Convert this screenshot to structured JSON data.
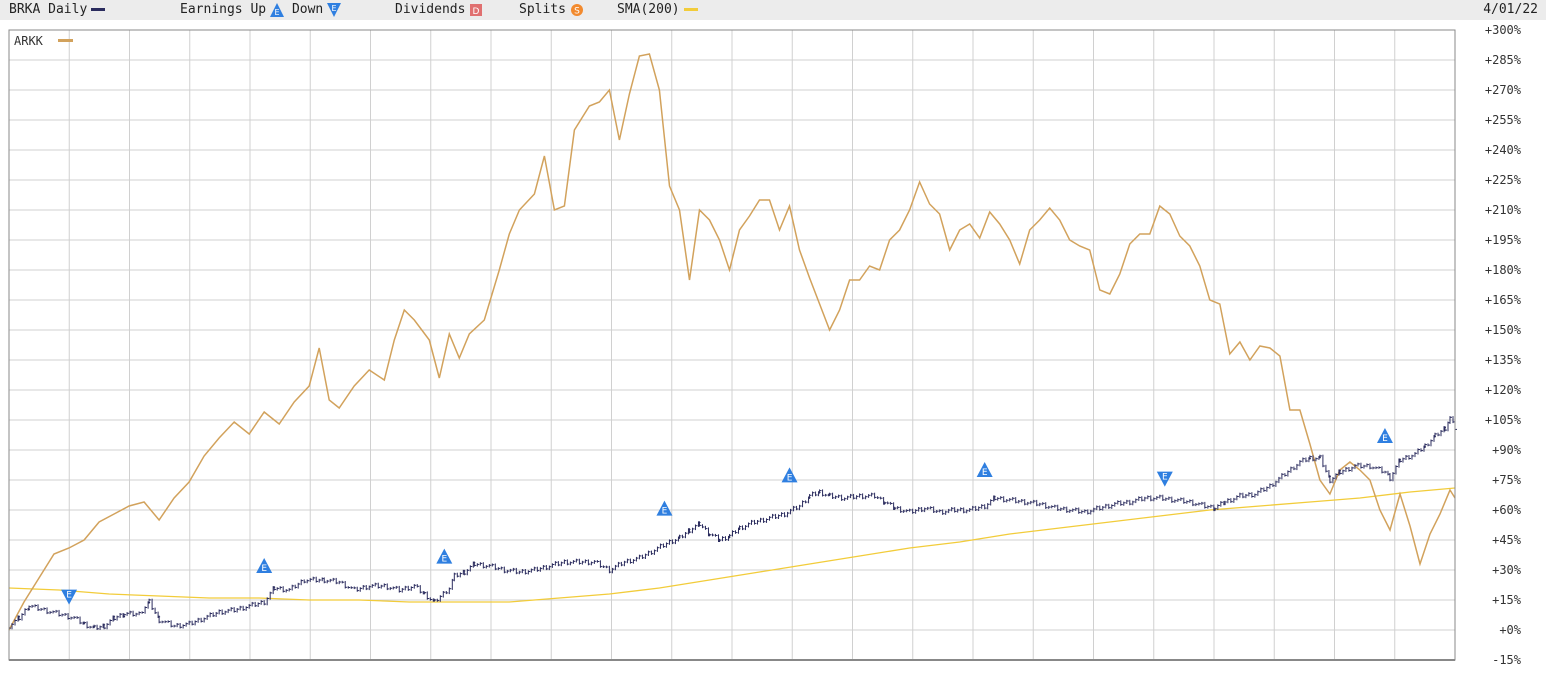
{
  "header": {
    "symbol_label": "BRKA Daily",
    "earnings_label": "Earnings",
    "up_label": "Up",
    "down_label": "Down",
    "dividends_label": "Dividends",
    "splits_label": "Splits",
    "sma_label": "SMA(200)",
    "date": "4/01/22",
    "colors": {
      "brka": "#2b2c5e",
      "arkk": "#d2a25c",
      "sma": "#f2cc3a",
      "earnings_icon": "#2f7fe0",
      "dividends_icon": "#e07070",
      "splits_icon": "#f28a2e"
    }
  },
  "chart_data": {
    "type": "line",
    "x_unit": "trading days (unlabeled time axis, ends 4/01/22)",
    "y_unit": "percent change",
    "ylim": [
      -15,
      300
    ],
    "y_ticks": [
      "+300%",
      "+285%",
      "+270%",
      "+255%",
      "+240%",
      "+225%",
      "+210%",
      "+195%",
      "+180%",
      "+165%",
      "+150%",
      "+135%",
      "+120%",
      "+105%",
      "+90%",
      "+75%",
      "+60%",
      "+45%",
      "+30%",
      "+15%",
      "+0%",
      "-15%"
    ],
    "grid": true,
    "inner_legend": "ARKK",
    "x_range": [
      0,
      1445
    ],
    "series": [
      {
        "name": "ARKK",
        "style": "line",
        "color": "#d2a25c",
        "points": [
          [
            0,
            0
          ],
          [
            15,
            14
          ],
          [
            30,
            26
          ],
          [
            45,
            38
          ],
          [
            60,
            41
          ],
          [
            75,
            45
          ],
          [
            90,
            54
          ],
          [
            105,
            58
          ],
          [
            120,
            62
          ],
          [
            135,
            64
          ],
          [
            150,
            55
          ],
          [
            165,
            66
          ],
          [
            180,
            74
          ],
          [
            195,
            87
          ],
          [
            210,
            96
          ],
          [
            225,
            104
          ],
          [
            240,
            98
          ],
          [
            255,
            109
          ],
          [
            270,
            103
          ],
          [
            285,
            114
          ],
          [
            300,
            122
          ],
          [
            310,
            141
          ],
          [
            320,
            115
          ],
          [
            330,
            111
          ],
          [
            345,
            122
          ],
          [
            360,
            130
          ],
          [
            375,
            125
          ],
          [
            385,
            145
          ],
          [
            395,
            160
          ],
          [
            405,
            155
          ],
          [
            420,
            145
          ],
          [
            430,
            126
          ],
          [
            440,
            148
          ],
          [
            450,
            136
          ],
          [
            460,
            148
          ],
          [
            475,
            155
          ],
          [
            490,
            180
          ],
          [
            500,
            198
          ],
          [
            510,
            210
          ],
          [
            525,
            218
          ],
          [
            535,
            237
          ],
          [
            545,
            210
          ],
          [
            555,
            212
          ],
          [
            565,
            250
          ],
          [
            580,
            262
          ],
          [
            590,
            264
          ],
          [
            600,
            270
          ],
          [
            610,
            245
          ],
          [
            620,
            268
          ],
          [
            630,
            287
          ],
          [
            640,
            288
          ],
          [
            650,
            270
          ],
          [
            660,
            222
          ],
          [
            670,
            210
          ],
          [
            680,
            175
          ],
          [
            690,
            210
          ],
          [
            700,
            205
          ],
          [
            710,
            195
          ],
          [
            720,
            180
          ],
          [
            730,
            200
          ],
          [
            740,
            207
          ],
          [
            750,
            215
          ],
          [
            760,
            215
          ],
          [
            770,
            200
          ],
          [
            780,
            212
          ],
          [
            790,
            190
          ],
          [
            800,
            176
          ],
          [
            810,
            163
          ],
          [
            820,
            150
          ],
          [
            830,
            160
          ],
          [
            840,
            175
          ],
          [
            850,
            175
          ],
          [
            860,
            182
          ],
          [
            870,
            180
          ],
          [
            880,
            195
          ],
          [
            890,
            200
          ],
          [
            900,
            210
          ],
          [
            910,
            224
          ],
          [
            920,
            213
          ],
          [
            930,
            208
          ],
          [
            940,
            190
          ],
          [
            950,
            200
          ],
          [
            960,
            203
          ],
          [
            970,
            196
          ],
          [
            980,
            209
          ],
          [
            990,
            203
          ],
          [
            1000,
            195
          ],
          [
            1010,
            183
          ],
          [
            1020,
            200
          ],
          [
            1030,
            205
          ],
          [
            1040,
            211
          ],
          [
            1050,
            205
          ],
          [
            1060,
            195
          ],
          [
            1070,
            192
          ],
          [
            1080,
            190
          ],
          [
            1090,
            170
          ],
          [
            1100,
            168
          ],
          [
            1110,
            178
          ],
          [
            1120,
            193
          ],
          [
            1130,
            198
          ],
          [
            1140,
            198
          ],
          [
            1150,
            212
          ],
          [
            1160,
            208
          ],
          [
            1170,
            197
          ],
          [
            1180,
            192
          ],
          [
            1190,
            182
          ],
          [
            1200,
            165
          ],
          [
            1210,
            163
          ],
          [
            1220,
            138
          ],
          [
            1230,
            144
          ],
          [
            1240,
            135
          ],
          [
            1250,
            142
          ],
          [
            1260,
            141
          ],
          [
            1270,
            137
          ],
          [
            1280,
            110
          ],
          [
            1290,
            110
          ],
          [
            1300,
            93
          ],
          [
            1310,
            75
          ],
          [
            1320,
            68
          ],
          [
            1330,
            80
          ],
          [
            1340,
            84
          ],
          [
            1350,
            80
          ],
          [
            1360,
            75
          ],
          [
            1370,
            60
          ],
          [
            1380,
            50
          ],
          [
            1390,
            68
          ],
          [
            1400,
            52
          ],
          [
            1410,
            33
          ],
          [
            1420,
            48
          ],
          [
            1430,
            58
          ],
          [
            1440,
            70
          ],
          [
            1445,
            66
          ]
        ]
      },
      {
        "name": "BRKA",
        "style": "bars",
        "color": "#2b2c5e",
        "points": [
          [
            0,
            2
          ],
          [
            10,
            6
          ],
          [
            20,
            12
          ],
          [
            35,
            10
          ],
          [
            50,
            8
          ],
          [
            65,
            6
          ],
          [
            75,
            3
          ],
          [
            85,
            1
          ],
          [
            95,
            2
          ],
          [
            105,
            6
          ],
          [
            115,
            8
          ],
          [
            130,
            8
          ],
          [
            140,
            14
          ],
          [
            150,
            5
          ],
          [
            165,
            2
          ],
          [
            180,
            3
          ],
          [
            195,
            6
          ],
          [
            210,
            9
          ],
          [
            225,
            10
          ],
          [
            240,
            12
          ],
          [
            255,
            14
          ],
          [
            265,
            21
          ],
          [
            280,
            20
          ],
          [
            295,
            25
          ],
          [
            315,
            25
          ],
          [
            330,
            24
          ],
          [
            345,
            20
          ],
          [
            360,
            22
          ],
          [
            375,
            22
          ],
          [
            390,
            20
          ],
          [
            405,
            22
          ],
          [
            415,
            18
          ],
          [
            425,
            14
          ],
          [
            440,
            21
          ],
          [
            445,
            27
          ],
          [
            455,
            29
          ],
          [
            465,
            33
          ],
          [
            480,
            32
          ],
          [
            495,
            30
          ],
          [
            510,
            29
          ],
          [
            525,
            30
          ],
          [
            540,
            32
          ],
          [
            555,
            34
          ],
          [
            570,
            34
          ],
          [
            585,
            34
          ],
          [
            600,
            30
          ],
          [
            615,
            34
          ],
          [
            630,
            36
          ],
          [
            645,
            40
          ],
          [
            660,
            44
          ],
          [
            670,
            46
          ],
          [
            680,
            50
          ],
          [
            690,
            53
          ],
          [
            700,
            48
          ],
          [
            710,
            45
          ],
          [
            720,
            47
          ],
          [
            730,
            51
          ],
          [
            745,
            54
          ],
          [
            760,
            56
          ],
          [
            775,
            58
          ],
          [
            790,
            62
          ],
          [
            800,
            67
          ],
          [
            810,
            69
          ],
          [
            820,
            67
          ],
          [
            835,
            66
          ],
          [
            850,
            67
          ],
          [
            865,
            67
          ],
          [
            875,
            64
          ],
          [
            885,
            61
          ],
          [
            900,
            59
          ],
          [
            915,
            61
          ],
          [
            930,
            59
          ],
          [
            945,
            60
          ],
          [
            960,
            60
          ],
          [
            975,
            62
          ],
          [
            985,
            66
          ],
          [
            1000,
            65
          ],
          [
            1015,
            64
          ],
          [
            1030,
            63
          ],
          [
            1045,
            61
          ],
          [
            1060,
            60
          ],
          [
            1075,
            59
          ],
          [
            1090,
            61
          ],
          [
            1105,
            63
          ],
          [
            1120,
            64
          ],
          [
            1135,
            66
          ],
          [
            1150,
            66
          ],
          [
            1165,
            65
          ],
          [
            1180,
            64
          ],
          [
            1195,
            62
          ],
          [
            1205,
            61
          ],
          [
            1215,
            64
          ],
          [
            1230,
            67
          ],
          [
            1245,
            68
          ],
          [
            1260,
            72
          ],
          [
            1275,
            78
          ],
          [
            1290,
            84
          ],
          [
            1300,
            86
          ],
          [
            1310,
            86
          ],
          [
            1320,
            75
          ],
          [
            1330,
            79
          ],
          [
            1345,
            82
          ],
          [
            1360,
            82
          ],
          [
            1375,
            79
          ],
          [
            1380,
            76
          ],
          [
            1390,
            85
          ],
          [
            1405,
            88
          ],
          [
            1415,
            92
          ],
          [
            1425,
            97
          ],
          [
            1435,
            101
          ],
          [
            1440,
            106
          ],
          [
            1445,
            101
          ]
        ]
      },
      {
        "name": "SMA(200)",
        "style": "line",
        "color": "#f2cc3a",
        "points": [
          [
            0,
            21
          ],
          [
            50,
            20
          ],
          [
            100,
            18
          ],
          [
            150,
            17
          ],
          [
            200,
            16
          ],
          [
            250,
            16
          ],
          [
            300,
            15
          ],
          [
            350,
            15
          ],
          [
            400,
            14
          ],
          [
            450,
            14
          ],
          [
            500,
            14
          ],
          [
            550,
            16
          ],
          [
            600,
            18
          ],
          [
            650,
            21
          ],
          [
            700,
            25
          ],
          [
            750,
            29
          ],
          [
            800,
            33
          ],
          [
            850,
            37
          ],
          [
            900,
            41
          ],
          [
            950,
            44
          ],
          [
            1000,
            48
          ],
          [
            1050,
            51
          ],
          [
            1100,
            54
          ],
          [
            1150,
            57
          ],
          [
            1200,
            60
          ],
          [
            1250,
            62
          ],
          [
            1300,
            64
          ],
          [
            1350,
            66
          ],
          [
            1400,
            69
          ],
          [
            1445,
            71
          ]
        ]
      }
    ],
    "earnings_markers": [
      {
        "x": 60,
        "direction": "down",
        "label": "E"
      },
      {
        "x": 255,
        "direction": "up",
        "label": "E"
      },
      {
        "x": 435,
        "direction": "up",
        "label": "E"
      },
      {
        "x": 655,
        "direction": "up",
        "label": "E"
      },
      {
        "x": 780,
        "direction": "up",
        "label": "E"
      },
      {
        "x": 975,
        "direction": "up",
        "label": "E"
      },
      {
        "x": 1155,
        "direction": "down",
        "label": "E"
      },
      {
        "x": 1375,
        "direction": "up",
        "label": "E"
      }
    ]
  }
}
